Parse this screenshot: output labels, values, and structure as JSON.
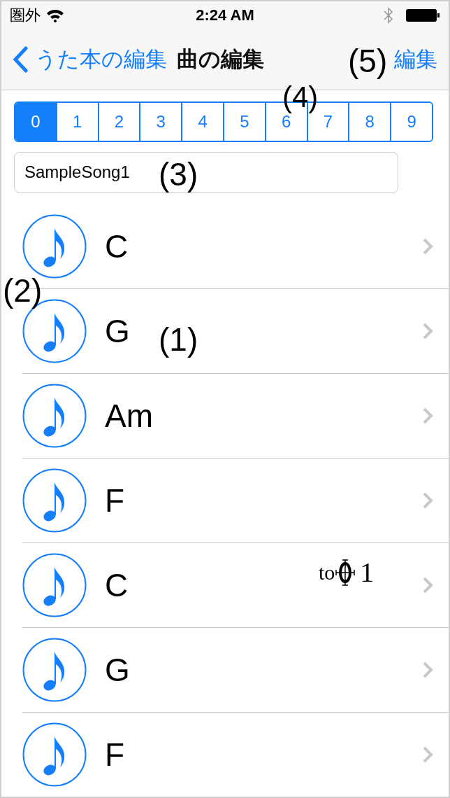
{
  "status_bar": {
    "carrier": "圏外",
    "time": "2:24 AM"
  },
  "nav_bar": {
    "back": "うた本の編集",
    "title": "曲の編集",
    "action": "編集"
  },
  "segments": [
    {
      "label": "0",
      "selected": true
    },
    {
      "label": "1",
      "selected": false
    },
    {
      "label": "2",
      "selected": false
    },
    {
      "label": "3",
      "selected": false
    },
    {
      "label": "4",
      "selected": false
    },
    {
      "label": "5",
      "selected": false
    },
    {
      "label": "6",
      "selected": false
    },
    {
      "label": "7",
      "selected": false
    },
    {
      "label": "8",
      "selected": false
    },
    {
      "label": "9",
      "selected": false
    }
  ],
  "song_name": {
    "value": "SampleSong1"
  },
  "rows": [
    {
      "chord": "C"
    },
    {
      "chord": "G"
    },
    {
      "chord": "Am"
    },
    {
      "chord": "F"
    },
    {
      "chord": "C",
      "jump": {
        "prefix": "to",
        "suffix": "1"
      }
    },
    {
      "chord": "G"
    },
    {
      "chord": "F"
    }
  ],
  "annotations": [
    "(5)",
    "(4)",
    "(3)",
    "(2)",
    "(1)"
  ]
}
